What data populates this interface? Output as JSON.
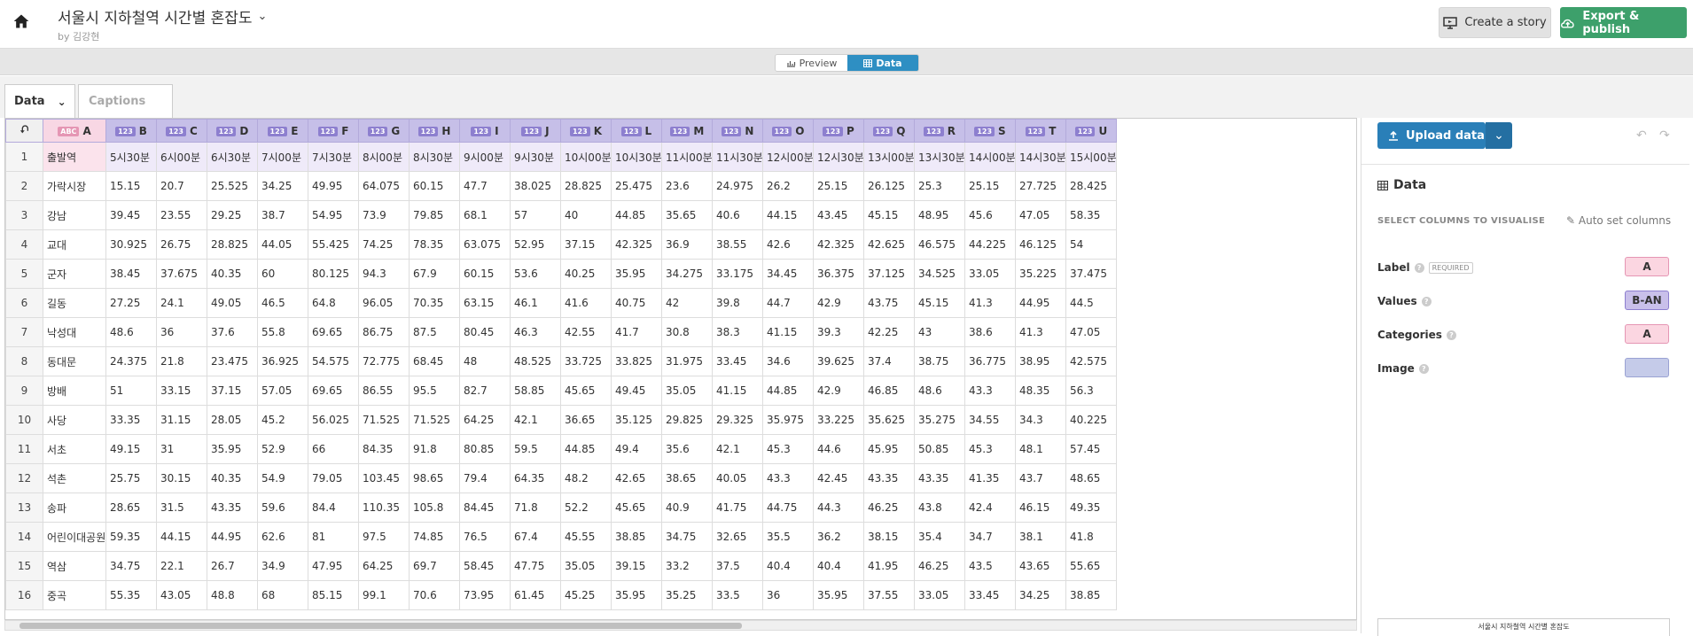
{
  "header": {
    "title": "서울시 지하철역 시간별 혼잡도",
    "byline": "by 김강현",
    "create_story": "Create a story",
    "export_publish": "Export & publish"
  },
  "mode": {
    "preview": "Preview",
    "data": "Data"
  },
  "tabs": {
    "data": "Data",
    "captions": "Captions"
  },
  "grid": {
    "col_letters": [
      "A",
      "B",
      "C",
      "D",
      "E",
      "F",
      "G",
      "H",
      "I",
      "J",
      "K",
      "L",
      "M",
      "N",
      "O",
      "P",
      "Q",
      "R",
      "S",
      "T",
      "U"
    ],
    "rows": [
      [
        "출발역",
        "5시30분",
        "6시00분",
        "6시30분",
        "7시00분",
        "7시30분",
        "8시00분",
        "8시30분",
        "9시00분",
        "9시30분",
        "10시00분",
        "10시30분",
        "11시00분",
        "11시30분",
        "12시00분",
        "12시30분",
        "13시00분",
        "13시30분",
        "14시00분",
        "14시30분",
        "15시00분"
      ],
      [
        "가락시장",
        "15.15",
        "20.7",
        "25.525",
        "34.25",
        "49.95",
        "64.075",
        "60.15",
        "47.7",
        "38.025",
        "28.825",
        "25.475",
        "23.6",
        "24.975",
        "26.2",
        "25.15",
        "26.125",
        "25.3",
        "25.15",
        "27.725",
        "28.425"
      ],
      [
        "강남",
        "39.45",
        "23.55",
        "29.25",
        "38.7",
        "54.95",
        "73.9",
        "79.85",
        "68.1",
        "57",
        "40",
        "44.85",
        "35.65",
        "40.6",
        "44.15",
        "43.45",
        "45.15",
        "48.95",
        "45.6",
        "47.05",
        "58.35"
      ],
      [
        "교대",
        "30.925",
        "26.75",
        "28.825",
        "44.05",
        "55.425",
        "74.25",
        "78.35",
        "63.075",
        "52.95",
        "37.15",
        "42.325",
        "36.9",
        "38.55",
        "42.6",
        "42.325",
        "42.625",
        "46.575",
        "44.225",
        "46.125",
        "54"
      ],
      [
        "군자",
        "38.45",
        "37.675",
        "40.35",
        "60",
        "80.125",
        "94.3",
        "67.9",
        "60.15",
        "53.6",
        "40.25",
        "35.95",
        "34.275",
        "33.175",
        "34.45",
        "36.375",
        "37.125",
        "34.525",
        "33.05",
        "35.225",
        "37.475"
      ],
      [
        "길동",
        "27.25",
        "24.1",
        "49.05",
        "46.5",
        "64.8",
        "96.05",
        "70.35",
        "63.15",
        "46.1",
        "41.6",
        "40.75",
        "42",
        "39.8",
        "44.7",
        "42.9",
        "43.75",
        "45.15",
        "41.3",
        "44.95",
        "44.5"
      ],
      [
        "낙성대",
        "48.6",
        "36",
        "37.6",
        "55.8",
        "69.65",
        "86.75",
        "87.5",
        "80.45",
        "46.3",
        "42.55",
        "41.7",
        "30.8",
        "38.3",
        "41.15",
        "39.3",
        "42.25",
        "43",
        "38.6",
        "41.3",
        "47.05"
      ],
      [
        "동대문",
        "24.375",
        "21.8",
        "23.475",
        "36.925",
        "54.575",
        "72.775",
        "68.45",
        "48",
        "48.525",
        "33.725",
        "33.825",
        "31.975",
        "33.45",
        "34.6",
        "39.625",
        "37.4",
        "38.75",
        "36.775",
        "38.95",
        "42.575"
      ],
      [
        "방배",
        "51",
        "33.15",
        "37.15",
        "57.05",
        "69.65",
        "86.55",
        "95.5",
        "82.7",
        "58.85",
        "45.65",
        "49.45",
        "35.05",
        "41.15",
        "44.85",
        "42.9",
        "46.85",
        "48.6",
        "43.3",
        "48.35",
        "56.3"
      ],
      [
        "사당",
        "33.35",
        "31.15",
        "28.05",
        "45.2",
        "56.025",
        "71.525",
        "71.525",
        "64.25",
        "42.1",
        "36.65",
        "35.125",
        "29.825",
        "29.325",
        "35.975",
        "33.225",
        "35.625",
        "35.275",
        "34.55",
        "34.3",
        "40.225"
      ],
      [
        "서초",
        "49.15",
        "31",
        "35.95",
        "52.9",
        "66",
        "84.35",
        "91.8",
        "80.85",
        "59.5",
        "44.85",
        "49.4",
        "35.6",
        "42.1",
        "45.3",
        "44.6",
        "45.95",
        "50.85",
        "45.3",
        "48.1",
        "57.45"
      ],
      [
        "석촌",
        "25.75",
        "30.15",
        "40.35",
        "54.9",
        "79.05",
        "103.45",
        "98.65",
        "79.4",
        "64.35",
        "48.2",
        "42.65",
        "38.65",
        "40.05",
        "43.3",
        "42.45",
        "43.35",
        "43.35",
        "41.35",
        "43.7",
        "48.65"
      ],
      [
        "송파",
        "28.65",
        "31.5",
        "43.35",
        "59.6",
        "84.4",
        "110.35",
        "105.8",
        "84.45",
        "71.8",
        "52.2",
        "45.65",
        "40.9",
        "41.75",
        "44.75",
        "44.3",
        "46.25",
        "43.8",
        "42.4",
        "46.15",
        "49.35"
      ],
      [
        "어린이대공원",
        "59.35",
        "44.15",
        "44.95",
        "62.6",
        "81",
        "97.5",
        "74.85",
        "76.5",
        "67.4",
        "45.55",
        "38.85",
        "34.75",
        "32.65",
        "35.5",
        "36.2",
        "38.15",
        "35.4",
        "34.7",
        "38.1",
        "41.8"
      ],
      [
        "역삼",
        "34.75",
        "22.1",
        "26.7",
        "34.9",
        "47.95",
        "64.25",
        "69.7",
        "58.45",
        "47.75",
        "35.05",
        "39.15",
        "33.2",
        "37.5",
        "40.4",
        "40.4",
        "41.95",
        "46.25",
        "43.5",
        "43.65",
        "55.65"
      ],
      [
        "중곡",
        "55.35",
        "43.05",
        "48.8",
        "68",
        "85.15",
        "99.1",
        "70.6",
        "73.95",
        "61.45",
        "45.25",
        "35.95",
        "35.25",
        "33.5",
        "36",
        "35.95",
        "37.55",
        "33.05",
        "33.45",
        "34.25",
        "38.85"
      ]
    ]
  },
  "sidebar": {
    "upload": "Upload data",
    "section_title": "Data",
    "select_label": "SELECT COLUMNS TO VISUALISE",
    "auto_set": "Auto set columns",
    "required": "REQUIRED",
    "fields": [
      {
        "label": "Label",
        "value": "A"
      },
      {
        "label": "Values",
        "value": "B-AN"
      },
      {
        "label": "Categories",
        "value": "A"
      },
      {
        "label": "Image",
        "value": ""
      }
    ],
    "thumb_title": "서울시 지하철역 시간별 혼잡도"
  }
}
